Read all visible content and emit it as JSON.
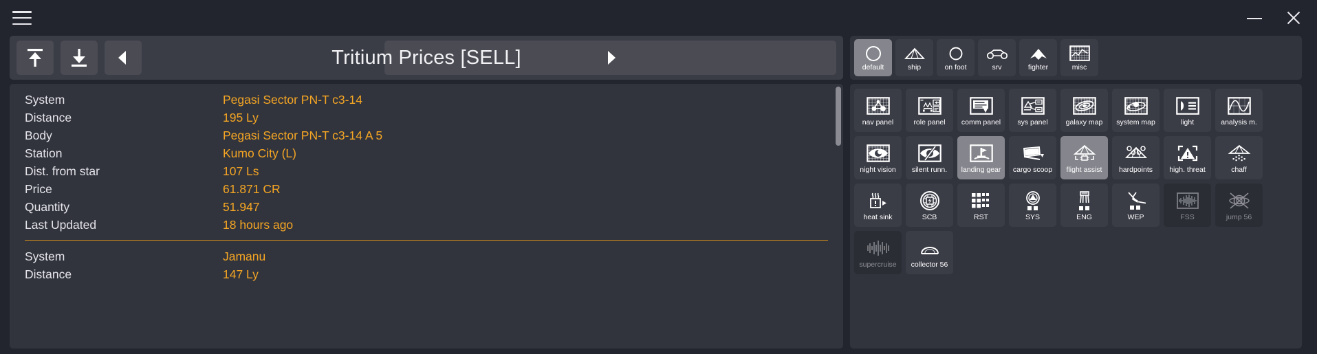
{
  "window": {
    "menu_icon": "hamburger-menu-icon",
    "minimize_label": "minimize-icon",
    "close_label": "close-icon"
  },
  "toolbar": {
    "title": "Tritium Prices [SELL]",
    "buttons": [
      {
        "name": "scroll-top-button",
        "icon": "arrow-up-to-line-icon"
      },
      {
        "name": "scroll-bottom-button",
        "icon": "arrow-down-to-line-icon"
      },
      {
        "name": "previous-page-button",
        "icon": "triangle-left-icon"
      }
    ],
    "next_button": {
      "name": "next-page-button",
      "icon": "triangle-right-icon"
    }
  },
  "list": {
    "records": [
      {
        "rows": [
          {
            "label": "System",
            "value": "Pegasi Sector PN-T c3-14"
          },
          {
            "label": "Distance",
            "value": "195 Ly"
          },
          {
            "label": "Body",
            "value": "Pegasi Sector PN-T c3-14 A 5"
          },
          {
            "label": "Station",
            "value": "Kumo City (L)"
          },
          {
            "label": "Dist. from star",
            "value": "107 Ls"
          },
          {
            "label": "Price",
            "value": "61.871 CR"
          },
          {
            "label": "Quantity",
            "value": "51.947"
          },
          {
            "label": "Last Updated",
            "value": "18 hours ago"
          }
        ]
      },
      {
        "rows": [
          {
            "label": "System",
            "value": "Jamanu"
          },
          {
            "label": "Distance",
            "value": "147 Ly"
          }
        ]
      }
    ],
    "accent_color": "#f5a623",
    "divider_color": "#c8871c"
  },
  "tabs": [
    {
      "label": "default",
      "icon": "circle-icon",
      "active": true
    },
    {
      "label": "ship",
      "icon": "ship-icon",
      "active": false
    },
    {
      "label": "on foot",
      "icon": "helmet-icon",
      "active": false
    },
    {
      "label": "srv",
      "icon": "srv-icon",
      "active": false
    },
    {
      "label": "fighter",
      "icon": "fighter-icon",
      "active": false
    },
    {
      "label": "misc",
      "icon": "waveform-box-icon",
      "active": false
    }
  ],
  "grid": [
    {
      "label": "nav panel",
      "icon": "nav-panel-icon",
      "state": "normal"
    },
    {
      "label": "role panel",
      "icon": "role-panel-icon",
      "state": "normal"
    },
    {
      "label": "comm panel",
      "icon": "comm-panel-icon",
      "state": "normal"
    },
    {
      "label": "sys panel",
      "icon": "sys-panel-icon",
      "state": "normal"
    },
    {
      "label": "galaxy map",
      "icon": "galaxy-map-icon",
      "state": "normal"
    },
    {
      "label": "system map",
      "icon": "system-map-icon",
      "state": "normal"
    },
    {
      "label": "light",
      "icon": "headlight-icon",
      "state": "normal"
    },
    {
      "label": "analysis m.",
      "icon": "analysis-mode-icon",
      "state": "normal"
    },
    {
      "label": "night vision",
      "icon": "eye-open-icon",
      "state": "normal"
    },
    {
      "label": "silent runn.",
      "icon": "eye-slash-icon",
      "state": "normal"
    },
    {
      "label": "landing gear",
      "icon": "landing-gear-icon",
      "state": "active"
    },
    {
      "label": "cargo scoop",
      "icon": "cargo-scoop-icon",
      "state": "normal"
    },
    {
      "label": "flight assist",
      "icon": "flight-assist-icon",
      "state": "active"
    },
    {
      "label": "hardpoints",
      "icon": "hardpoints-icon",
      "state": "normal"
    },
    {
      "label": "high. threat",
      "icon": "warning-icon",
      "state": "normal"
    },
    {
      "label": "chaff",
      "icon": "chaff-icon",
      "state": "normal"
    },
    {
      "label": "heat sink",
      "icon": "heat-sink-icon",
      "state": "normal"
    },
    {
      "label": "SCB",
      "icon": "shield-cell-icon",
      "state": "normal"
    },
    {
      "label": "RST",
      "icon": "reset-pips-icon",
      "state": "normal"
    },
    {
      "label": "SYS",
      "icon": "pips-sys-icon",
      "state": "normal"
    },
    {
      "label": "ENG",
      "icon": "pips-eng-icon",
      "state": "normal"
    },
    {
      "label": "WEP",
      "icon": "pips-wep-icon",
      "state": "normal"
    },
    {
      "label": "FSS",
      "icon": "fss-icon",
      "state": "dim"
    },
    {
      "label": "jump 56",
      "icon": "frameshift-icon",
      "state": "dim"
    },
    {
      "label": "supercruise",
      "icon": "supercruise-icon",
      "state": "dim"
    },
    {
      "label": "collector 56",
      "icon": "limpet-icon",
      "state": "normal"
    }
  ]
}
